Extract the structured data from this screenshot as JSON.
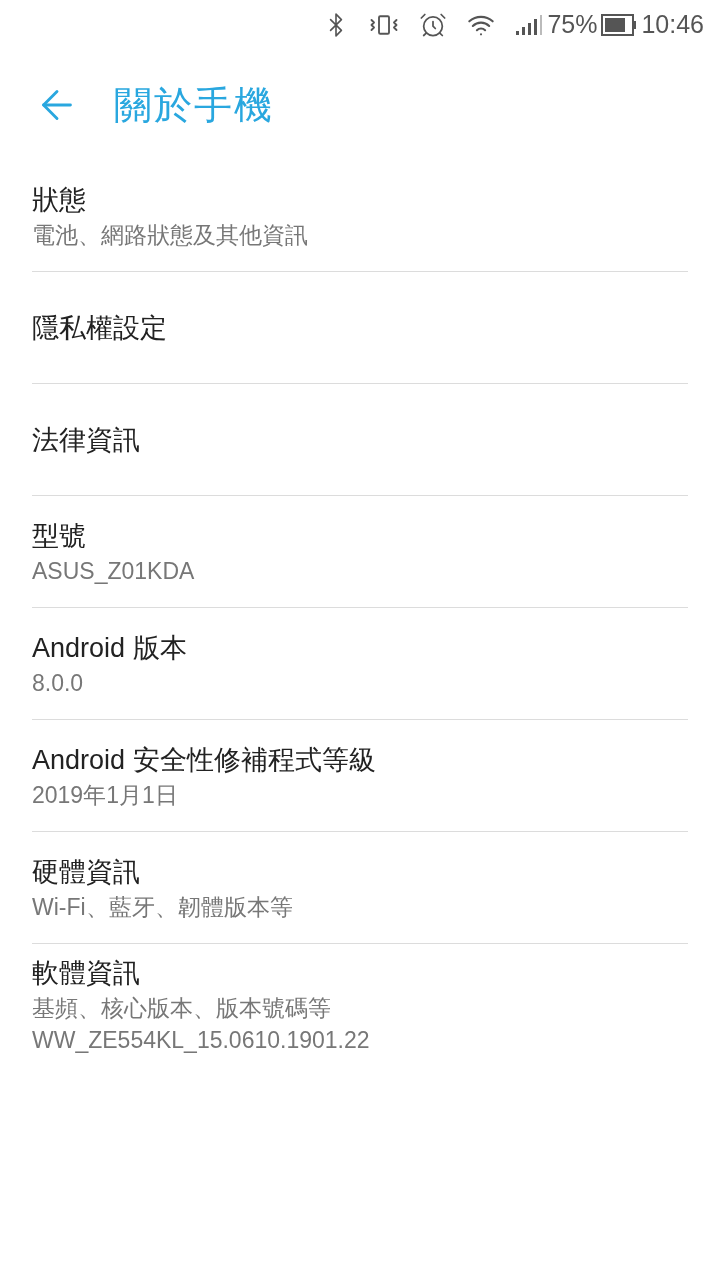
{
  "status_bar": {
    "battery_percent": "75%",
    "time": "10:46"
  },
  "app_bar": {
    "title": "關於手機"
  },
  "items": [
    {
      "title": "狀態",
      "summary": [
        "電池、網路狀態及其他資訊"
      ]
    },
    {
      "title": "隱私權設定"
    },
    {
      "title": "法律資訊"
    },
    {
      "title": "型號",
      "summary": [
        "ASUS_Z01KDA"
      ]
    },
    {
      "title": "Android 版本",
      "summary": [
        "8.0.0"
      ]
    },
    {
      "title": "Android 安全性修補程式等級",
      "summary": [
        "2019年1月1日"
      ]
    },
    {
      "title": "硬體資訊",
      "summary": [
        "Wi-Fi、藍牙、韌體版本等"
      ]
    },
    {
      "title": "軟體資訊",
      "summary": [
        "基頻、核心版本、版本號碼等",
        "WW_ZE554KL_15.0610.1901.22"
      ]
    }
  ]
}
